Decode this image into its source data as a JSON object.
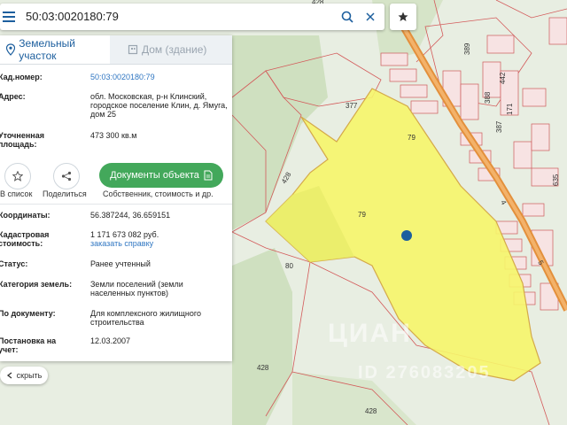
{
  "search": {
    "value": "50:03:0020180:79"
  },
  "tabs": [
    {
      "label": "Земельный участок"
    },
    {
      "label": "Дом (здание)"
    }
  ],
  "info": {
    "cad_label": "Кад.номер:",
    "cad_value": "50:03:0020180:79",
    "address_label": "Адрес:",
    "address_value": "обл. Московская, р-н Клинский, городское поселение Клин, д. Ямуга, дом 25",
    "area_label_1": "Уточненная",
    "area_label_2": "площадь:",
    "area_value": "473 300 кв.м",
    "coords_label": "Координаты:",
    "coords_value": "56.387244, 36.659151",
    "cost_label_1": "Кадастровая",
    "cost_label_2": "стоимость:",
    "cost_value": "1 171 673 082 руб.",
    "cost_link": "заказать справку",
    "status_label": "Статус:",
    "status_value": "Ранее учтенный",
    "category_label": "Категория земель:",
    "category_value": "Земли поселений (земли населенных пунктов)",
    "doc_label": "По документу:",
    "doc_value": "Для комплексного жилищного строительства",
    "reg_label_1": "Постановка на",
    "reg_label_2": "учет:",
    "reg_value": "12.03.2007"
  },
  "actions": {
    "save_label": "В список",
    "share_label": "Поделиться",
    "docs_button": "Документы объекта",
    "docs_sub": "Собственник, стоимость и др."
  },
  "hide_button": "скрыть",
  "map": {
    "labels": [
      "428",
      "377",
      "79",
      "428",
      "79",
      "80",
      "428",
      "428",
      "389",
      "442",
      "388",
      "171",
      "387",
      "4",
      "5",
      "635"
    ],
    "watermark_1": "ЦИАН",
    "watermark_2": "ID 276083205"
  },
  "colors": {
    "parcel": "#f6f56a",
    "accent": "#1d5f9e",
    "button": "#43a85b",
    "road": "#e3903c"
  }
}
